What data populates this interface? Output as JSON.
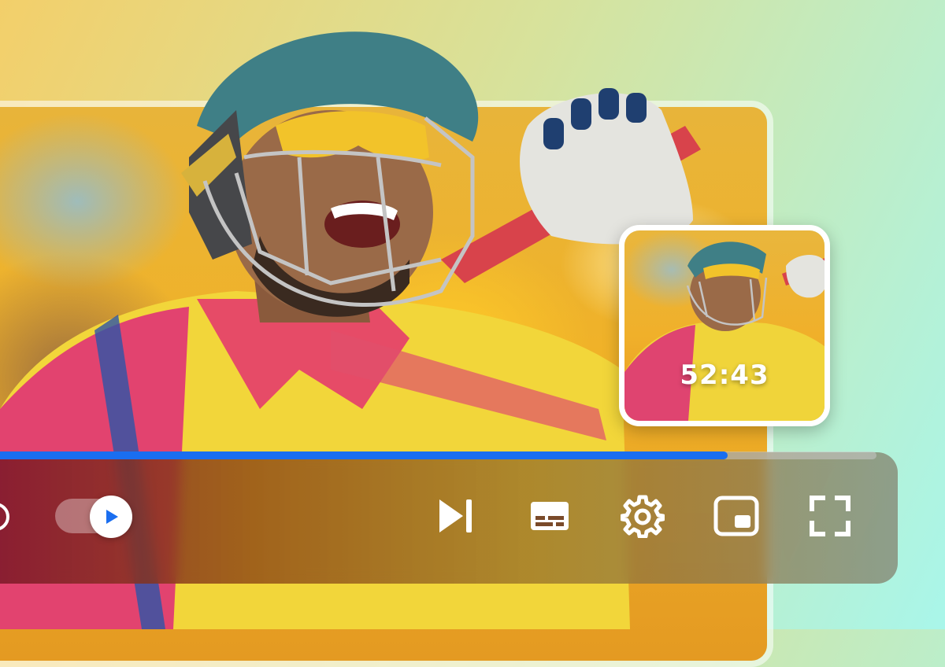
{
  "player": {
    "preview_time": "52:43",
    "progress_fraction": 0.83,
    "accent_color": "#1a6ef0"
  },
  "controls": {
    "replay_icon": "replay-icon",
    "autoplay_toggle": {
      "state": "on",
      "icon": "play-icon"
    },
    "next_icon": "skip-next-icon",
    "captions_icon": "subtitles-icon",
    "settings_icon": "gear-icon",
    "miniplayer_icon": "picture-in-picture-icon",
    "fullscreen_icon": "fullscreen-icon"
  }
}
